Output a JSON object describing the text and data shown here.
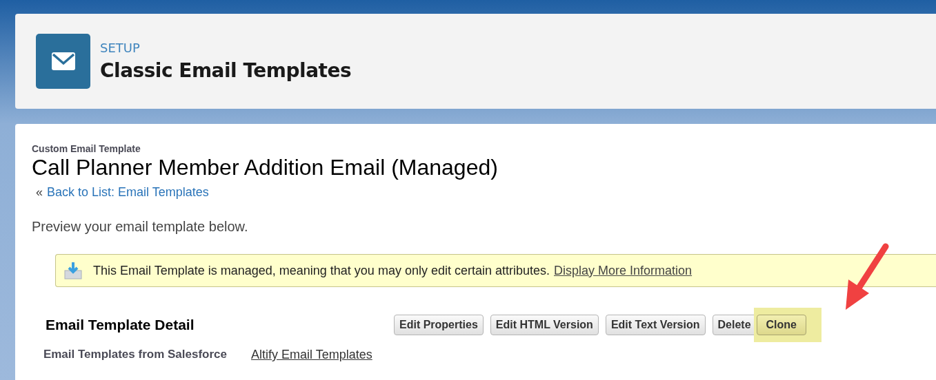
{
  "header": {
    "eyebrow": "SETUP",
    "title": "Classic Email Templates"
  },
  "record": {
    "type_label": "Custom Email Template",
    "title": "Call Planner Member Addition Email (Managed)",
    "back_prefix": "«",
    "back_link": "Back to List: Email Templates"
  },
  "intro": "Preview your email template below.",
  "notice": {
    "text": "This Email Template is managed, meaning that you may only edit certain attributes.",
    "link": "Display More Information"
  },
  "detail": {
    "heading": "Email Template Detail",
    "buttons": [
      {
        "label": "Edit Properties",
        "highlighted": false
      },
      {
        "label": "Edit HTML Version",
        "highlighted": false
      },
      {
        "label": "Edit Text Version",
        "highlighted": false
      },
      {
        "label": "Delete",
        "highlighted": false
      },
      {
        "label": "Clone",
        "highlighted": true
      }
    ],
    "fields": [
      {
        "label": "Email Templates from Salesforce",
        "value": "Altify Email Templates"
      }
    ]
  }
}
